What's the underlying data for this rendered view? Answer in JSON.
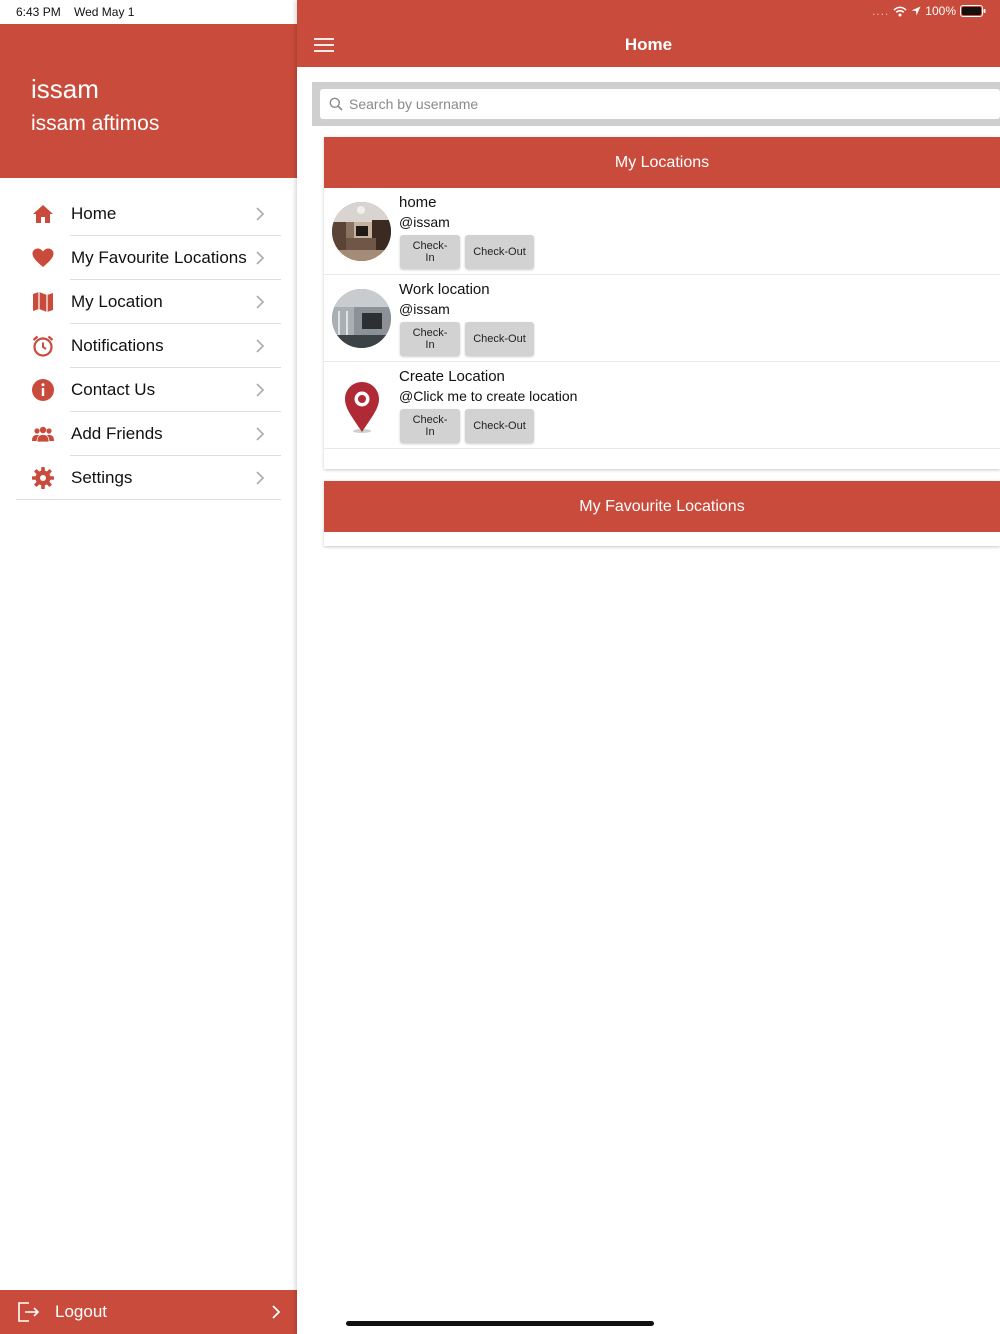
{
  "status_bar": {
    "time": "6:43 PM",
    "date": "Wed May 1",
    "signal": "....",
    "battery": "100%"
  },
  "drawer": {
    "username": "issam",
    "full_name": "issam aftimos",
    "items": [
      {
        "label": "Home",
        "icon": "home-icon"
      },
      {
        "label": "My Favourite Locations",
        "icon": "heart-icon"
      },
      {
        "label": "My Location",
        "icon": "map-icon"
      },
      {
        "label": "Notifications",
        "icon": "alarm-clock-icon"
      },
      {
        "label": "Contact Us",
        "icon": "info-icon"
      },
      {
        "label": "Add Friends",
        "icon": "people-icon"
      },
      {
        "label": "Settings",
        "icon": "gear-icon"
      }
    ],
    "logout_label": "Logout"
  },
  "header": {
    "title": "Home"
  },
  "search": {
    "placeholder": "Search by username",
    "value": ""
  },
  "my_locations": {
    "title": "My Locations",
    "items": [
      {
        "name": "home",
        "user": "@issam",
        "checkin_label": "Check-In",
        "checkout_label": "Check-Out",
        "image": "home-photo"
      },
      {
        "name": "Work location",
        "user": "@issam",
        "checkin_label": "Check-In",
        "checkout_label": "Check-Out",
        "image": "office-photo"
      },
      {
        "name": "Create Location",
        "user": "@Click me to create location",
        "checkin_label": "Check-In",
        "checkout_label": "Check-Out",
        "image": "map-pin-icon"
      }
    ]
  },
  "favourite_locations": {
    "title": "My Favourite Locations"
  },
  "colors": {
    "accent": "#c94b3c",
    "button_gray": "#d2d2d2",
    "search_bar_bg": "#cfcfcf"
  }
}
